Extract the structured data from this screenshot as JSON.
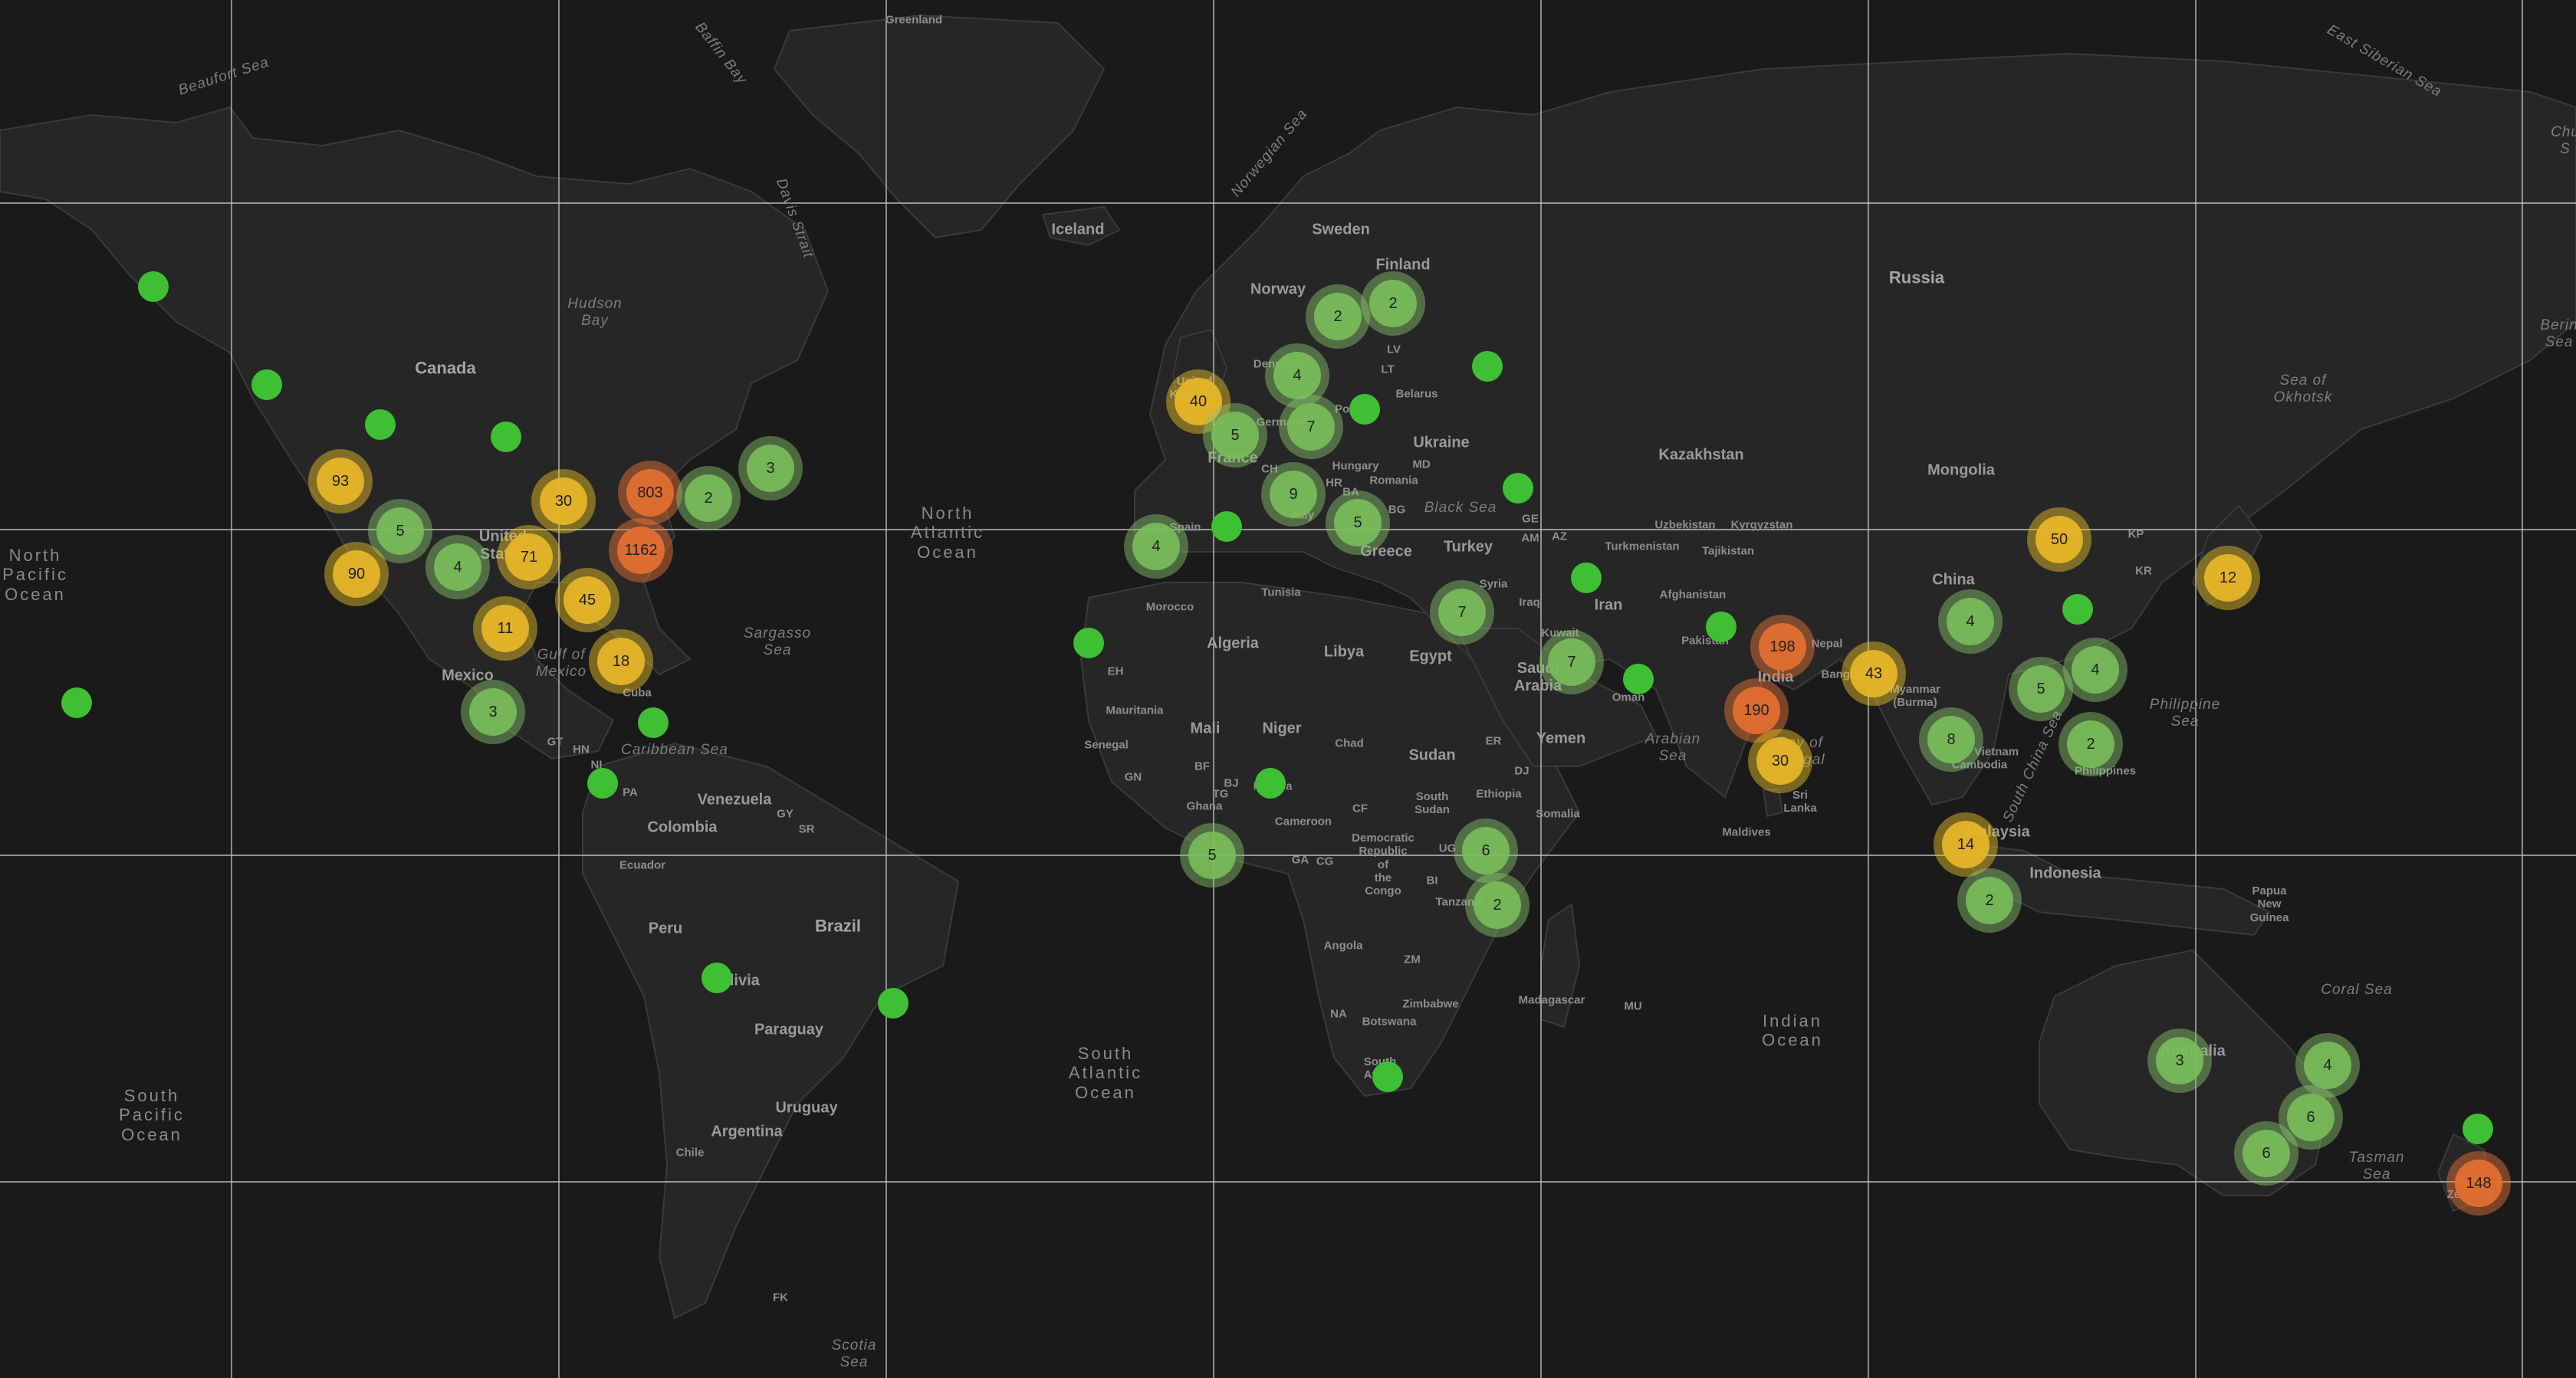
{
  "map": {
    "style": "dark-basemap",
    "colors": {
      "background": "#1a1a1a",
      "land": "#262626",
      "graticule": "#d8d8d8",
      "point": "#3fbf33",
      "cluster_small": "#78be5a",
      "cluster_medium": "#e6b428",
      "cluster_large": "#e16e32"
    }
  },
  "labels": {
    "oceans": {
      "north_pacific": "North\nPacific\nOcean",
      "south_pacific": "South\nPacific\nOcean",
      "north_atlantic": "North\nAtlantic\nOcean",
      "south_atlantic": "South\nAtlantic\nOcean",
      "indian": "Indian\nOcean"
    },
    "seas": {
      "beaufort": "Beaufort Sea",
      "baffin": "Baffin Bay",
      "hudson": "Hudson\nBay",
      "davis": "Davis Strait",
      "norwegian": "Norwegian Sea",
      "sargasso": "Sargasso\nSea",
      "gulf_mexico": "Gulf of\nMexico",
      "caribbean": "Caribbean Sea",
      "black": "Black Sea",
      "arabian": "Arabian\nSea",
      "bengal": "Bay of\nBengal",
      "south_china": "South China Sea",
      "philippine": "Philippine\nSea",
      "okhotsk": "Sea of\nOkhotsk",
      "east_siberian": "East Siberian Sea",
      "bering": "Berin\nSea",
      "coral": "Coral Sea",
      "tasman": "Tasman\nSea",
      "scotia": "Scotia\nSea",
      "chu": "Chu\nS"
    },
    "countries": {
      "greenland": "Greenland",
      "iceland": "Iceland",
      "canada": "Canada",
      "united_states": "United\nStates",
      "mexico": "Mexico",
      "cuba": "Cuba",
      "venezuela": "Venezuela",
      "colombia": "Colombia",
      "ecuador": "Ecuador",
      "peru": "Peru",
      "brazil": "Brazil",
      "bolivia": "Bolivia",
      "paraguay": "Paraguay",
      "uruguay": "Uruguay",
      "argentina": "Argentina",
      "chile": "Chile",
      "sweden": "Sweden",
      "finland": "Finland",
      "norway": "Norway",
      "united_kingdom": "United\nKingdom",
      "denmark": "Denmark",
      "germany": "Germany",
      "poland": "Poland",
      "belarus": "Belarus",
      "ukraine": "Ukraine",
      "france": "France",
      "spain": "Spain",
      "italy": "Italy",
      "hungary": "Hungary",
      "romania": "Romania",
      "greece": "Greece",
      "turkey": "Turkey",
      "russia": "Russia",
      "kazakhstan": "Kazakhstan",
      "mongolia": "Mongolia",
      "china": "China",
      "uzbekistan": "Uzbekistan",
      "kyrgyzstan": "Kyrgyzstan",
      "turkmenistan": "Turkmenistan",
      "tajikistan": "Tajikistan",
      "afghanistan": "Afghanistan",
      "pakistan": "Pakistan",
      "iran": "Iran",
      "iraq": "Iraq",
      "syria": "Syria",
      "kuwait": "Kuwait",
      "saudi_arabia": "Saudi\nArabia",
      "oman": "Oman",
      "yemen": "Yemen",
      "india": "India",
      "nepal": "Nepal",
      "bangladesh": "Bangladesh",
      "myanmar": "Myanmar\n(Burma)",
      "vietnam": "Vietnam",
      "cambodia": "Cambodia",
      "philippines": "Philippines",
      "malaysia": "Malaysia",
      "indonesia": "Indonesia",
      "papua": "Papua\nNew\nGuinea",
      "australia": "Australia",
      "new_zealand": "New\nZealand",
      "sri_lanka": "Sri\nLanka",
      "maldives": "Maldives",
      "morocco": "Morocco",
      "algeria": "Algeria",
      "tunisia": "Tunisia",
      "libya": "Libya",
      "egypt": "Egypt",
      "mauritania": "Mauritania",
      "mali": "Mali",
      "niger": "Niger",
      "chad": "Chad",
      "sudan": "Sudan",
      "south_sudan": "South\nSudan",
      "ethiopia": "Ethiopia",
      "somalia": "Somalia",
      "senegal": "Senegal",
      "ghana": "Ghana",
      "nigeria": "Nigeria",
      "cameroon": "Cameroon",
      "drc": "Democratic\nRepublic\nof\nthe\nCongo",
      "tanzania": "Tanzania",
      "angola": "Angola",
      "zimbabwe": "Zimbabwe",
      "botswana": "Botswana",
      "south_africa": "South\nAfrica",
      "madagascar": "Madagascar",
      "namibia": "NA",
      "zambia": "ZM",
      "mauritius": "MU",
      "falkland": "FK",
      "eh": "EH",
      "gn": "GN",
      "bf": "BF",
      "bj": "BJ",
      "tg": "TG",
      "cf": "CF",
      "ga": "GA",
      "cg": "CG",
      "ug": "UG",
      "bi": "BI",
      "er": "ER",
      "dj": "DJ",
      "gt": "GT",
      "hn": "HN",
      "ni": "NI",
      "pa": "PA",
      "gy": "GY",
      "sr": "SR",
      "lv": "LV",
      "lt": "LT",
      "md": "MD",
      "hr": "HR",
      "ba": "BA",
      "bg": "BG",
      "ch": "CH",
      "ge": "GE",
      "az": "AZ",
      "am": "AM",
      "kp": "KP",
      "kr": "KR",
      "jp": "J"
    }
  },
  "clusters": [
    {
      "count": "2",
      "tier": "small"
    },
    {
      "count": "2",
      "tier": "small"
    },
    {
      "count": "4",
      "tier": "small"
    },
    {
      "count": "40",
      "tier": "medium"
    },
    {
      "count": "5",
      "tier": "small"
    },
    {
      "count": "7",
      "tier": "small"
    },
    {
      "count": "9",
      "tier": "small"
    },
    {
      "count": "5",
      "tier": "small"
    },
    {
      "count": "4",
      "tier": "small"
    },
    {
      "count": "93",
      "tier": "medium"
    },
    {
      "count": "30",
      "tier": "medium"
    },
    {
      "count": "803",
      "tier": "large"
    },
    {
      "count": "2",
      "tier": "small"
    },
    {
      "count": "3",
      "tier": "small"
    },
    {
      "count": "5",
      "tier": "small"
    },
    {
      "count": "1162",
      "tier": "large"
    },
    {
      "count": "90",
      "tier": "medium"
    },
    {
      "count": "4",
      "tier": "small"
    },
    {
      "count": "71",
      "tier": "medium"
    },
    {
      "count": "45",
      "tier": "medium"
    },
    {
      "count": "11",
      "tier": "medium"
    },
    {
      "count": "18",
      "tier": "medium"
    },
    {
      "count": "3",
      "tier": "small"
    },
    {
      "count": "7",
      "tier": "small"
    },
    {
      "count": "7",
      "tier": "small"
    },
    {
      "count": "198",
      "tier": "large"
    },
    {
      "count": "190",
      "tier": "large"
    },
    {
      "count": "43",
      "tier": "medium"
    },
    {
      "count": "30",
      "tier": "medium"
    },
    {
      "count": "50",
      "tier": "medium"
    },
    {
      "count": "12",
      "tier": "medium"
    },
    {
      "count": "4",
      "tier": "small"
    },
    {
      "count": "5",
      "tier": "small"
    },
    {
      "count": "4",
      "tier": "small"
    },
    {
      "count": "8",
      "tier": "small"
    },
    {
      "count": "2",
      "tier": "small"
    },
    {
      "count": "14",
      "tier": "medium"
    },
    {
      "count": "2",
      "tier": "small"
    },
    {
      "count": "6",
      "tier": "small"
    },
    {
      "count": "2",
      "tier": "small"
    },
    {
      "count": "5",
      "tier": "small"
    },
    {
      "count": "3",
      "tier": "small"
    },
    {
      "count": "4",
      "tier": "small"
    },
    {
      "count": "6",
      "tier": "small"
    },
    {
      "count": "6",
      "tier": "small"
    },
    {
      "count": "148",
      "tier": "large"
    }
  ]
}
